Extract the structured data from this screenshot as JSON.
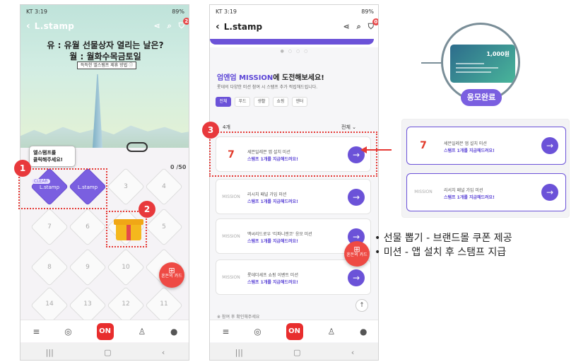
{
  "phone1": {
    "status": {
      "left": "KT 3:19",
      "right": "89%"
    },
    "header": {
      "title": "L.stamp"
    },
    "cart_count": "2",
    "headline1": "유 : 유월 선물상자 열리는 날은?",
    "headline2": "월 : 월화수목금토일",
    "notice_tag": "득득한 엘스탬프 제휴 방법 ⓘ",
    "tooltip": "엘스탬프를\n클릭해주세요!",
    "count": "0 /50",
    "clear_tag": "CLEAR",
    "stamp_label": "L.stamp",
    "cells": [
      "3",
      "4",
      "5",
      "6",
      "7",
      "8",
      "9",
      "10",
      "11",
      "12",
      "13",
      "14"
    ],
    "fab_label": "혼돈의 카드",
    "nav": {
      "on": "ON"
    }
  },
  "phone2": {
    "status": {
      "left": "KT 3:19",
      "right": "89%"
    },
    "header": {
      "title": "L.stamp"
    },
    "cart_count": "0",
    "mission_title_hl": "엄엔엄 MISSION",
    "mission_title_rest": "에 도전해보세요!",
    "mission_sub": "롯데의 다양한 미션 참여 시 스탬프 추가 적립해드립니다.",
    "tabs": [
      "전체",
      "푸드",
      "생활",
      "쇼핑",
      "엔터"
    ],
    "list_count": "4개",
    "sort": "전체  ⌄",
    "missions": [
      {
        "logo": "7",
        "name": "세븐일레븐 앱 설치 미션",
        "reward": "스탬프 1개를 지급해드려요!"
      },
      {
        "logo": "MISSION",
        "name": "리시치 패널 가입 미션",
        "reward": "스탬프 1개를 지급해드려요!"
      },
      {
        "logo": "MISSION",
        "name": "맥씨리드로우 '티파니앤코' 응모 미션",
        "reward": "스탬프 1개를 지급해드려요!"
      },
      {
        "logo": "MISSION",
        "name": "롯데더셰프 쇼핑 이벤트 미션",
        "reward": "스탬프 1개를 지급해드려요!"
      }
    ],
    "partial_text": "※ 참여 후 확인해주세요",
    "fab_label": "혼돈의 카드",
    "nav": {
      "on": "ON"
    }
  },
  "markers": [
    "1",
    "2",
    "3"
  ],
  "illustration": {
    "coupon_amount": "1,000원",
    "done_label": "응모완료",
    "cards": [
      {
        "logo": "7",
        "name": "세븐일레븐 앱 설치 미션",
        "reward": "스탬프 1개를 지급해드려요!"
      },
      {
        "logo": "MISSION",
        "name": "리서치 패널 가입 미션",
        "reward": "스탬프 1개를 지급해드려요!"
      }
    ]
  },
  "bullets": [
    "• 선물 뽑기 - 브랜드몰 쿠폰 제공",
    "• 미션 - 앱 설치 후 스탬프 지급"
  ],
  "colors": {
    "accent": "#6b52d8",
    "marker": "#e8393c",
    "on_red": "#e82d2d"
  }
}
